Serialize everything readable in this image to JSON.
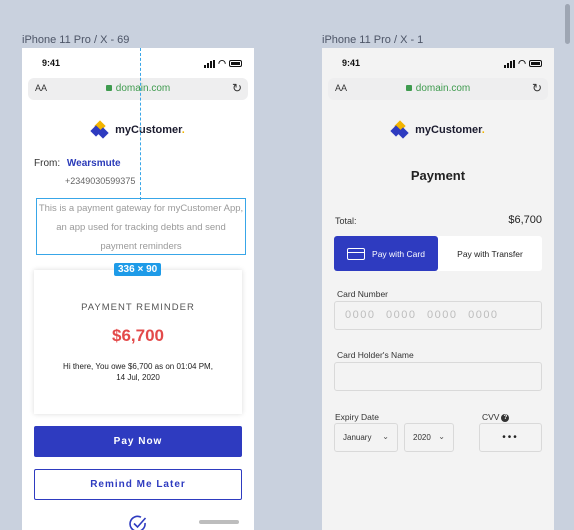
{
  "frames": [
    {
      "title": "iPhone 11 Pro / X - 69"
    },
    {
      "title": "iPhone 11 Pro / X - 1"
    }
  ],
  "status": {
    "time": "9:41"
  },
  "browser": {
    "text_size": "AA",
    "url": "domain.com"
  },
  "brand": {
    "name": "myCustomer",
    "dot": ".",
    "colors": {
      "blue": "#2e3bc0",
      "yellow": "#f2b400",
      "red": "#e34a4a"
    }
  },
  "screen1": {
    "from_label": "From:",
    "sender": "Wearsmute",
    "sender_phone": "+2349030599375",
    "description": "This is a payment gateway for myCustomer App, an app used for tracking debts and send payment reminders",
    "dimension_badge": "336 × 90",
    "card": {
      "title": "PAYMENT REMINDER",
      "amount": "$6,700",
      "message": "Hi there, You owe $6,700 as on 01:04 PM, 14 Jul, 2020"
    },
    "pay_now": "Pay Now",
    "remind_later": "Remind Me Later"
  },
  "screen2": {
    "title": "Payment",
    "total_label": "Total:",
    "total_value": "$6,700",
    "tabs": [
      {
        "label": "Pay with Card",
        "active": true
      },
      {
        "label": "Pay with Transfer",
        "active": false
      }
    ],
    "card_number_label": "Card Number",
    "card_number_placeholder": "0000 0000 0000 0000",
    "holder_label": "Card Holder's Name",
    "expiry_label": "Expiry Date",
    "month": "January",
    "year": "2020",
    "cvv_label": "CVV",
    "cvv_value": "•••"
  }
}
